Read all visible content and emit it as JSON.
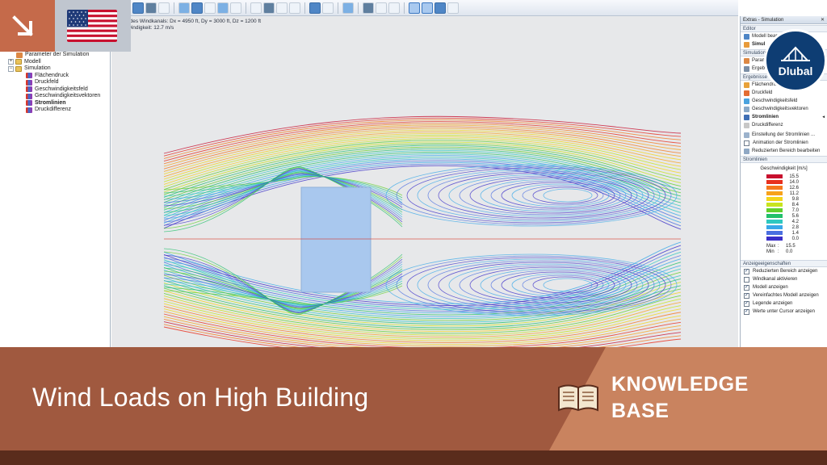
{
  "viewport": {
    "info_line1": "nen des Windkanals: Dx = 4950 ft, Dy = 3000 ft, Dz = 1200 ft",
    "info_line2": "schwindigkeit: 12.7 m/s"
  },
  "navigator": {
    "items": [
      {
        "label": "Parameter der Simulation",
        "level": 1
      },
      {
        "label": "Modell",
        "level": 0
      },
      {
        "label": "Simulation",
        "level": 0
      },
      {
        "label": "Flächendruck",
        "level": 2
      },
      {
        "label": "Druckfeld",
        "level": 2
      },
      {
        "label": "Geschwindigkeitsfeld",
        "level": 2
      },
      {
        "label": "Geschwindigkeitsvektoren",
        "level": 2
      },
      {
        "label": "Stromlinien",
        "level": 2
      },
      {
        "label": "Druckdifferenz",
        "level": 2
      }
    ]
  },
  "right_panel": {
    "title": "Extras - Simulation",
    "close": "✕",
    "sections": {
      "editor": "Editor",
      "simulation": "Simulation",
      "results": "Ergebnisse",
      "streamlines": "Stromlinien",
      "display": "Anzeigeeigenschaften"
    },
    "editor_items": [
      "Modell bear",
      "Simul"
    ],
    "simulation_items": [
      "Param",
      "Ergeb"
    ],
    "result_items": [
      "Flächendruck",
      "Druckfeld",
      "Geschwindigkeitsfeld",
      "Geschwindigkeitsvektoren",
      "Stromlinien",
      "Druckdifferenz"
    ],
    "result_arrow": "◂",
    "extra_items": [
      "Einstellung der Stromlinien ...",
      "Animation der Stromlinien",
      "Reduzierten Bereich bearbeiten"
    ],
    "legend_title": "Geschwindigkeit [m/s]",
    "legend": [
      {
        "value": "15.5",
        "color": "#c8102e"
      },
      {
        "value": "14.0",
        "color": "#e8301e"
      },
      {
        "value": "12.6",
        "color": "#f5781e"
      },
      {
        "value": "11.2",
        "color": "#f7a21c"
      },
      {
        "value": "9.8",
        "color": "#f4d41a"
      },
      {
        "value": "8.4",
        "color": "#c8e41e"
      },
      {
        "value": "7.0",
        "color": "#62d02c"
      },
      {
        "value": "5.6",
        "color": "#22c06a"
      },
      {
        "value": "4.2",
        "color": "#2ec8c0"
      },
      {
        "value": "2.8",
        "color": "#38a8e8"
      },
      {
        "value": "1.4",
        "color": "#4a6ee0"
      },
      {
        "value": "0.0",
        "color": "#3a2ec8"
      }
    ],
    "max_label": "Max",
    "min_label": "Min",
    "sep": ":",
    "max_value": "15.5",
    "min_value": "0.0",
    "display_items": [
      {
        "label": "Reduzierten Bereich anzeigen",
        "checked": true
      },
      {
        "label": "Windkanal aktivieren",
        "checked": false
      },
      {
        "label": "Modell anzeigen",
        "checked": true
      },
      {
        "label": "Vereinfachtes Modell anzeigen",
        "checked": true
      },
      {
        "label": "Legende anzeigen",
        "checked": true
      },
      {
        "label": "Werte unter Cursor anzeigen",
        "checked": true
      }
    ]
  },
  "badge": {
    "name": "Dlubal"
  },
  "banner": {
    "title": "Wind Loads on High Building",
    "kb_line1": "KNOWLEDGE",
    "kb_line2": "BASE"
  },
  "colors": {
    "banner": "#a0593f",
    "banner_accent": "#c9835f",
    "banner_strip": "#5a2c1c",
    "corner": "#c56a4a",
    "dlubal_blue": "#0e3d73",
    "building": "#a9c8ee",
    "viewport_bg": "#e7e8ea"
  },
  "icons": [
    "arrow-down-right-icon",
    "us-flag-icon",
    "dlubal-logo-icon",
    "book-icon",
    "folder-icon",
    "results-icon",
    "checkbox-icon"
  ]
}
